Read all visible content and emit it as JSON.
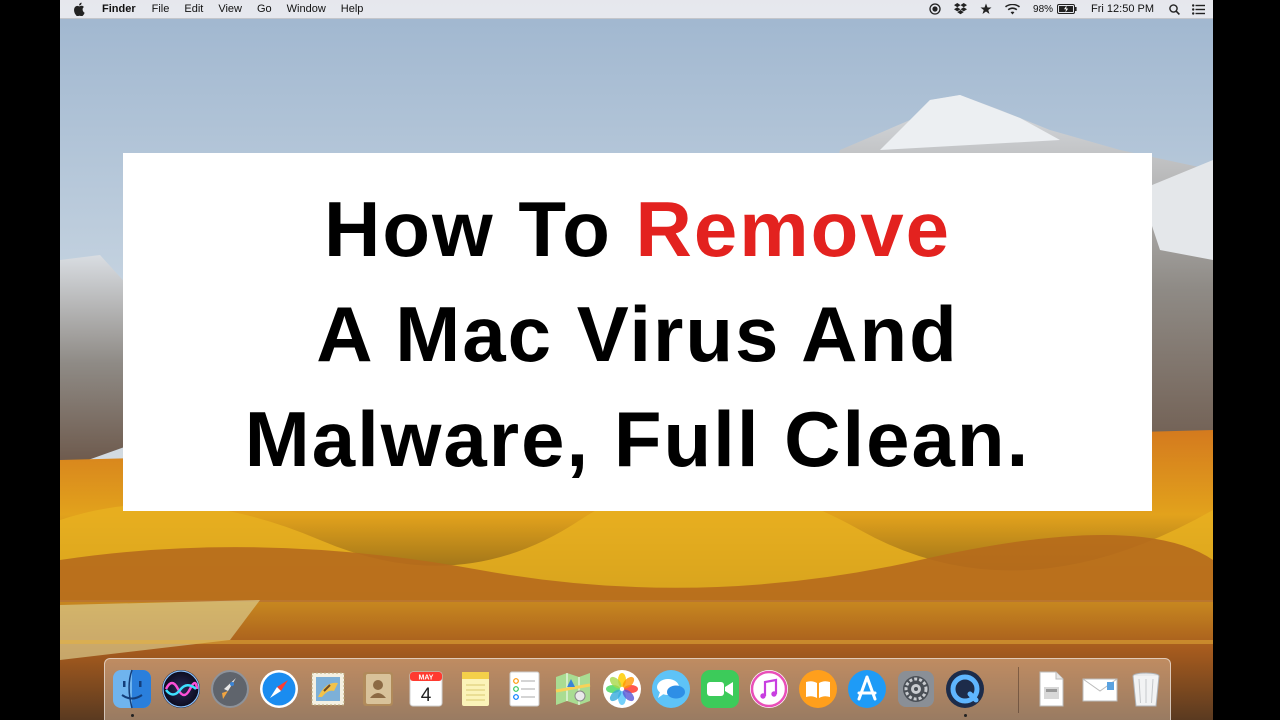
{
  "menubar": {
    "app_name": "Finder",
    "menus": [
      "File",
      "Edit",
      "View",
      "Go",
      "Window",
      "Help"
    ],
    "battery_percent": "98%",
    "clock": "Fri 12:50 PM"
  },
  "title_card": {
    "line1_part1": "How To ",
    "line1_highlight": "Remove",
    "line2": "A Mac Virus And",
    "line3": "Malware, Full Clean.",
    "highlight_color": "#e3221f"
  },
  "dock": {
    "apps": [
      "finder",
      "siri",
      "launchpad",
      "safari",
      "mail",
      "contacts",
      "calendar",
      "notes",
      "reminders",
      "maps",
      "photos",
      "messages",
      "facetime",
      "itunes",
      "ibooks",
      "app-store",
      "system-preferences",
      "quicktime",
      "file-document",
      "mail-attachment",
      "trash"
    ],
    "calendar_month": "MAY",
    "calendar_day": "4"
  }
}
